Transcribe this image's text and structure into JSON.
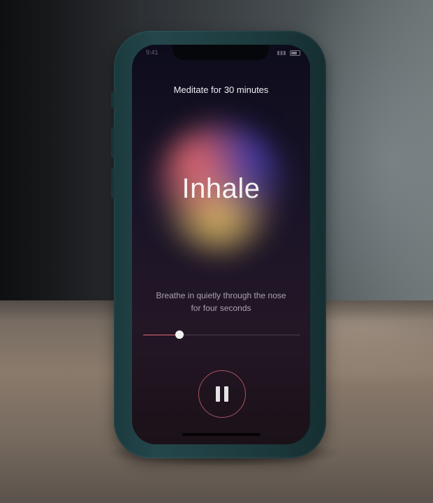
{
  "status_bar": {
    "time": "9:41",
    "signal": "▮▮▮"
  },
  "session": {
    "title": "Meditate for 30 minutes",
    "phase": "Inhale",
    "instruction": "Breathe in quietly through the nose for four seconds",
    "progress_fraction": 0.23
  },
  "controls": {
    "pause_icon": "pause-icon"
  },
  "colors": {
    "accent": "#e06a7a",
    "phone_case": "#1f4044",
    "screen_bg": "#1a1428"
  }
}
